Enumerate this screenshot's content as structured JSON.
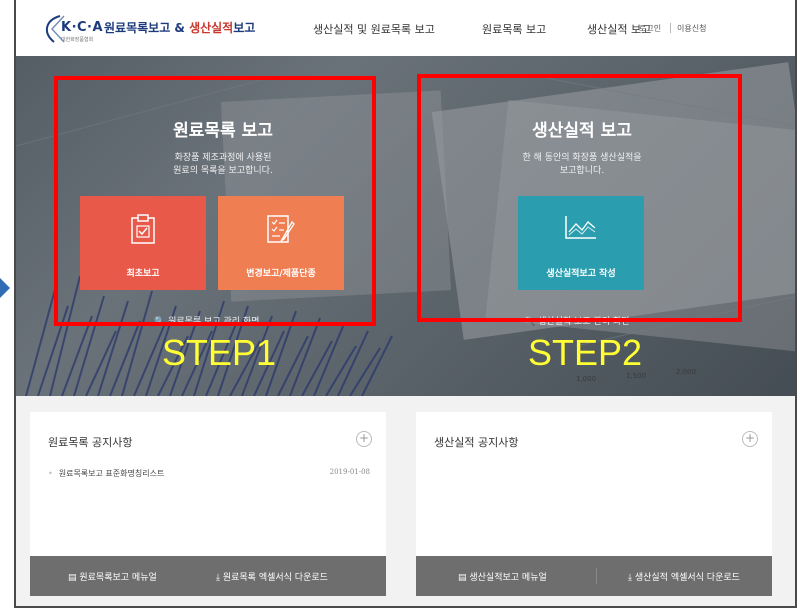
{
  "header": {
    "logo_text": "K·C·A",
    "logo_sub": "대한화장품협회",
    "title_part1": "원료목록보고 & ",
    "title_part2": "생산실적",
    "title_part3": "보고",
    "nav": [
      "생산실적 및 원료목록 보고",
      "원료목록 보고",
      "생산실적 보고"
    ],
    "login": "로그인",
    "terms": "이용신청"
  },
  "left_panel": {
    "title": "원료목록 보고",
    "desc_line1": "화장품 제조과정에 사용된",
    "desc_line2": "원료의 목록을 보고합니다.",
    "tiles": [
      {
        "label": "최초보고",
        "color": "#e9594a",
        "icon": "clipboard-check-icon"
      },
      {
        "label": "변경보고/제품단종",
        "color": "#ef7e52",
        "icon": "document-edit-icon"
      }
    ],
    "hidden_link": "원료목록 보고 관리 화면"
  },
  "right_panel": {
    "title": "생산실적 보고",
    "desc_line1": "한 해 동안의 화장품 생산실적을",
    "desc_line2": "보고합니다.",
    "tile": {
      "label": "생산실적보고 작성",
      "color": "#2a9eae",
      "icon": "line-chart-icon"
    },
    "hidden_link": "생산실적 보고 관리 화면"
  },
  "annotations": {
    "step1": "STEP1",
    "step2": "STEP2",
    "box_color": "#ff0000",
    "step_color": "#ffff33"
  },
  "notices": {
    "left": {
      "title": "원료목록 공지사항",
      "items": [
        {
          "title": "원료목록보고 표준화명칭리스트",
          "date": "2019-01-08"
        }
      ],
      "manual": "원료목록보고 메뉴얼",
      "download": "원료목록 엑셀서식 다운로드"
    },
    "right": {
      "title": "생산실적 공지사항",
      "items": [],
      "manual": "생산실적보고 메뉴얼",
      "download": "생산실적 엑셀서식 다운로드"
    }
  }
}
